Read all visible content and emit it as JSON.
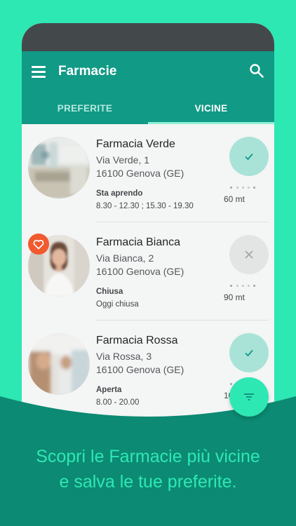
{
  "app": {
    "title": "Farmacie",
    "menu_icon": "hamburger-menu-icon",
    "search_icon": "search-icon"
  },
  "tabs": [
    {
      "label": "PREFERITE",
      "selected": false
    },
    {
      "label": "VICINE",
      "selected": true
    }
  ],
  "pharmacies": [
    {
      "name": "Farmacia Verde",
      "street": "Via Verde, 1",
      "city": "16100 Genova (GE)",
      "status": "Sta aprendo",
      "hours": "8.30 - 12.30 ; 15.30 - 19.30",
      "distance": "60 mt",
      "open": true,
      "favorite": false
    },
    {
      "name": "Farmacia Bianca",
      "street": "Via Bianca, 2",
      "city": "16100 Genova (GE)",
      "status": "Chiusa",
      "hours": "Oggi chiusa",
      "distance": "90 mt",
      "open": false,
      "favorite": true
    },
    {
      "name": "Farmacia Rossa",
      "street": "Via Rossa, 3",
      "city": "16100 Genova (GE)",
      "status": "Aperta",
      "hours": "8.00 - 20.00",
      "distance": "100 mt",
      "open": true,
      "favorite": false
    }
  ],
  "fab_icon": "filter-icon",
  "tagline": {
    "line1": "Scopri le Farmacie più vicine",
    "line2": "e salva le tue preferite."
  },
  "colors": {
    "background": "#2ee8b4",
    "app_bar": "#119a86",
    "wave": "#0c8a73",
    "favorite_badge": "#f05a2e",
    "open_indicator": "#a9e3d8",
    "closed_indicator": "#e3e4e4"
  }
}
